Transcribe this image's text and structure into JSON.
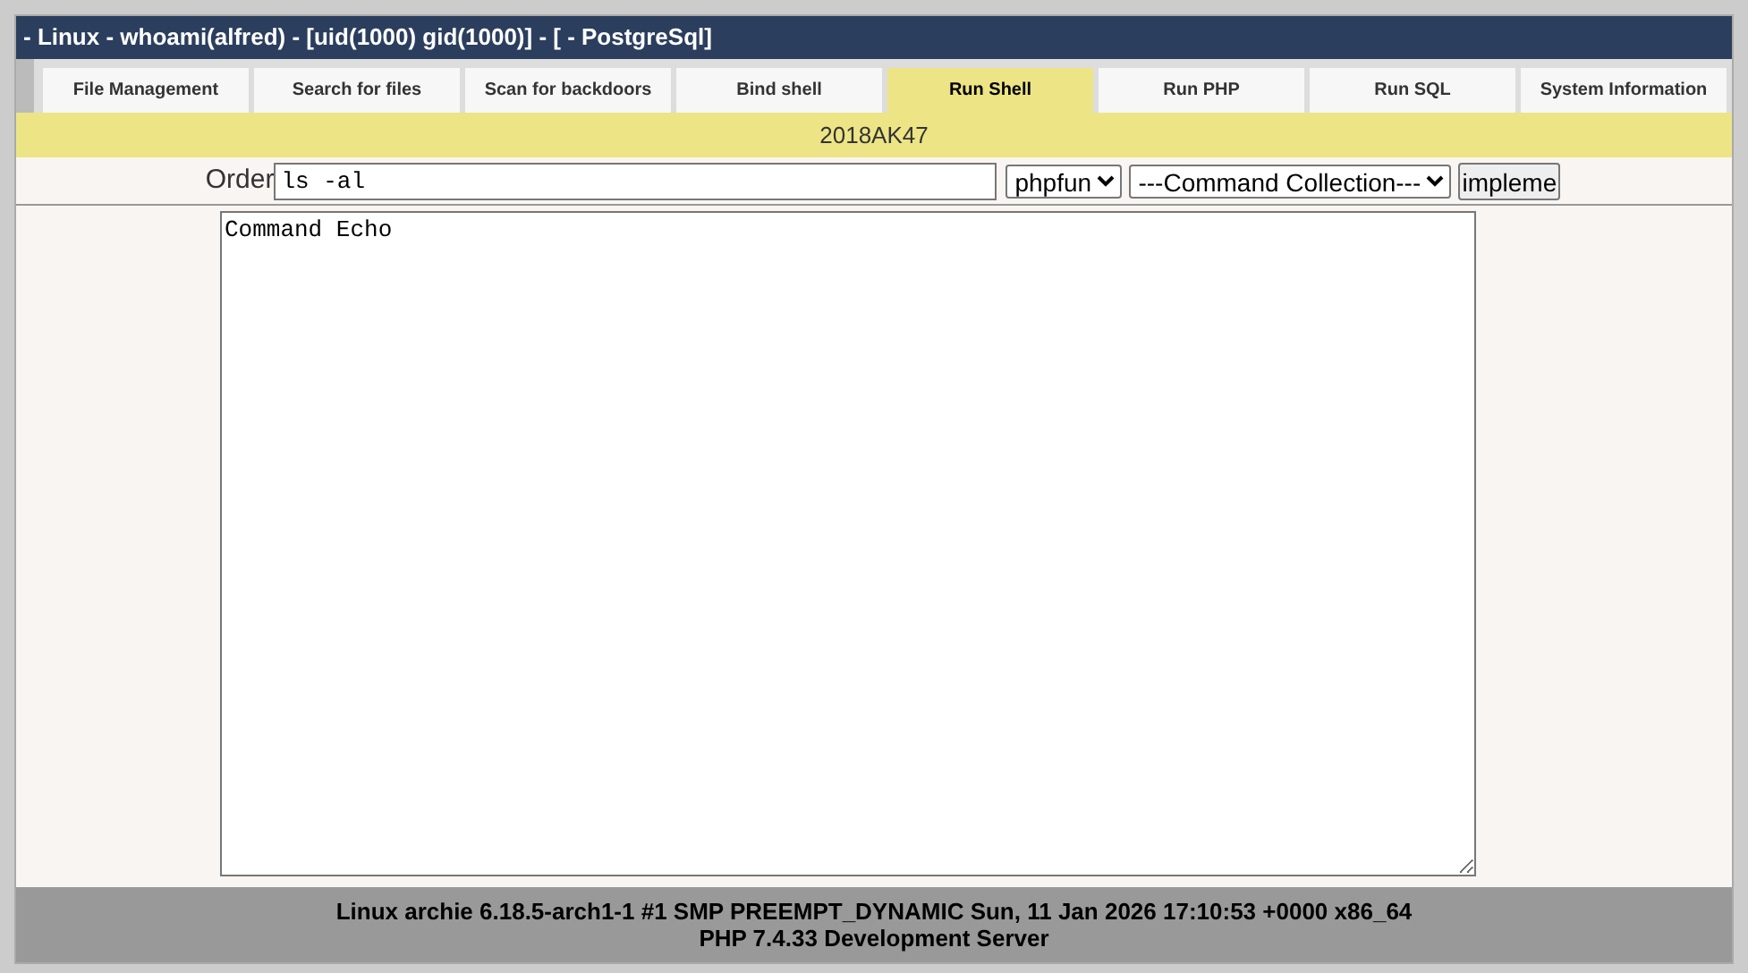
{
  "window": {
    "title": "- Linux - whoami(alfred) - [uid(1000) gid(1000)] - [ - PostgreSql]"
  },
  "tabs": [
    {
      "label": "File Management",
      "selected": false
    },
    {
      "label": "Search for files",
      "selected": false
    },
    {
      "label": "Scan for backdoors",
      "selected": false
    },
    {
      "label": "Bind shell",
      "selected": false
    },
    {
      "label": "Run Shell",
      "selected": true
    },
    {
      "label": "Run PHP",
      "selected": false
    },
    {
      "label": "Run SQL",
      "selected": false
    },
    {
      "label": "System Information",
      "selected": false
    }
  ],
  "banner": "2018AK47",
  "command_form": {
    "label": "Order",
    "value": "ls -al",
    "function_select": "phpfun",
    "collection_select": "---Command Collection---",
    "submit": "impleme"
  },
  "output": {
    "value": "Command Echo"
  },
  "status_bar": {
    "lines": [
      "Linux archie 6.18.5-arch1-1 #1 SMP PREEMPT_DYNAMIC Sun, 11 Jan 2026 17:10:53 +0000 x86_64",
      "PHP 7.4.33 Development Server"
    ]
  }
}
